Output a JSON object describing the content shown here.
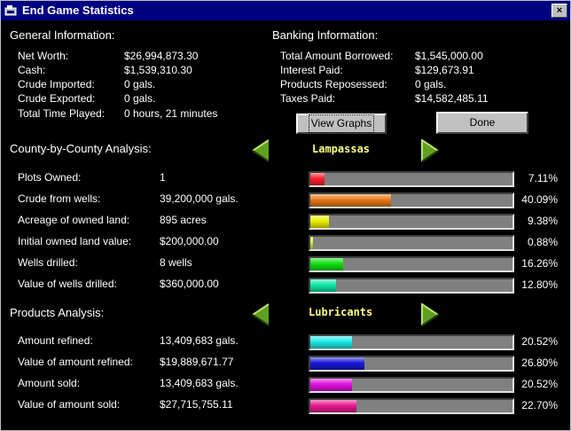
{
  "window": {
    "title": "End Game Statistics",
    "close_glyph": "×"
  },
  "general": {
    "heading": "General Information:",
    "rows": [
      {
        "label": "Net Worth:",
        "value": "$26,994,873.30"
      },
      {
        "label": "Cash:",
        "value": "$1,539,310.30"
      },
      {
        "label": "Crude Imported:",
        "value": "0 gals."
      },
      {
        "label": "Crude Exported:",
        "value": "0 gals."
      },
      {
        "label": "Total Time Played:",
        "value": "0 hours, 21 minutes"
      }
    ]
  },
  "banking": {
    "heading": "Banking Information:",
    "rows": [
      {
        "label": "Total Amount Borrowed:",
        "value": "$1,545,000.00"
      },
      {
        "label": "Interest Paid:",
        "value": "$129,673.91"
      },
      {
        "label": "Products Reposessed:",
        "value": "0 gals."
      },
      {
        "label": "Taxes Paid:",
        "value": "$14,582,485.11"
      }
    ]
  },
  "buttons": {
    "view_graphs": "View Graphs",
    "done": "Done"
  },
  "county": {
    "heading": "County-by-County Analysis:",
    "selected": "Lampassas",
    "rows": [
      {
        "label": "Plots Owned:",
        "value": "1",
        "percent": "7.11%",
        "fraction": 0.0711,
        "color": "#ff2030"
      },
      {
        "label": "Crude from wells:",
        "value": "39,200,000 gals.",
        "percent": "40.09%",
        "fraction": 0.4009,
        "color": "#e87818"
      },
      {
        "label": "Acreage of owned land:",
        "value": "895 acres",
        "percent": "9.38%",
        "fraction": 0.0938,
        "color": "#f0f000"
      },
      {
        "label": "Initial owned land value:",
        "value": "$200,000.00",
        "percent": "0.88%",
        "fraction": 0.0088,
        "color": "#d8f040"
      },
      {
        "label": "Wells drilled:",
        "value": "8 wells",
        "percent": "16.26%",
        "fraction": 0.1626,
        "color": "#10e010"
      },
      {
        "label": "Value of wells drilled:",
        "value": "$360,000.00",
        "percent": "12.80%",
        "fraction": 0.128,
        "color": "#10e8a8"
      }
    ]
  },
  "products": {
    "heading": "Products Analysis:",
    "selected": "Lubricants",
    "rows": [
      {
        "label": "Amount refined:",
        "value": "13,409,683 gals.",
        "percent": "20.52%",
        "fraction": 0.2052,
        "color": "#20e8e8"
      },
      {
        "label": "Value of amount refined:",
        "value": "$19,889,671.77",
        "percent": "26.80%",
        "fraction": 0.268,
        "color": "#1818d8"
      },
      {
        "label": "Amount sold:",
        "value": "13,409,683 gals.",
        "percent": "20.52%",
        "fraction": 0.2052,
        "color": "#e010e0"
      },
      {
        "label": "Value of amount sold:",
        "value": "$27,715,755.11",
        "percent": "22.70%",
        "fraction": 0.227,
        "color": "#e81890"
      }
    ]
  }
}
